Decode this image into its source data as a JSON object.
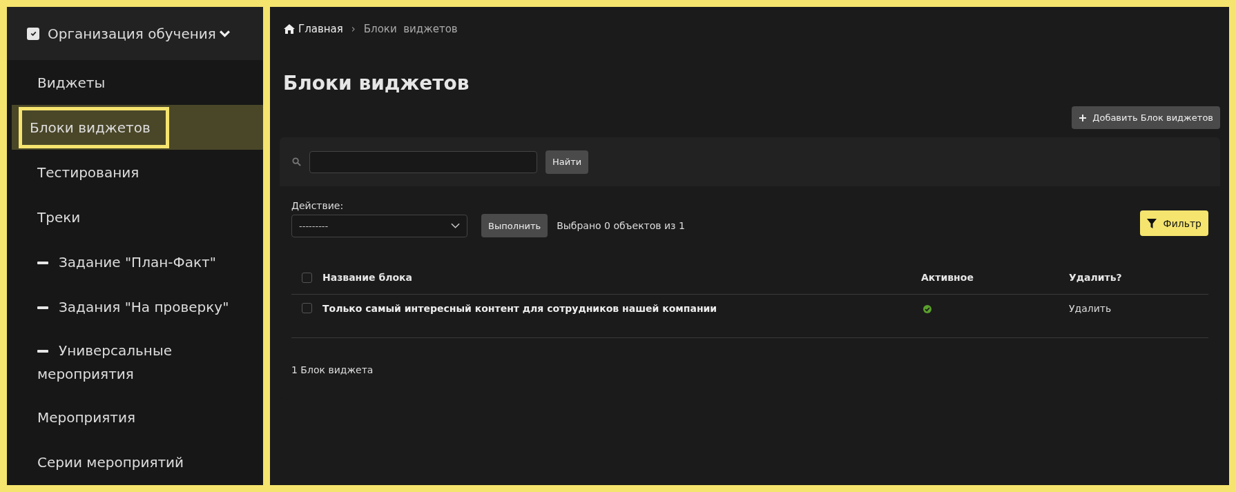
{
  "sidebar": {
    "header": {
      "label": "Организация обучения",
      "checked": true,
      "expanded": true
    },
    "items": [
      {
        "label": "Виджеты",
        "kind": "link",
        "selected": false
      },
      {
        "label": "Блоки виджетов",
        "kind": "link",
        "selected": true
      },
      {
        "label": "Тестирования",
        "kind": "link",
        "selected": false
      },
      {
        "label": "Треки",
        "kind": "link",
        "selected": false
      },
      {
        "label": "Задание \"План-Факт\"",
        "kind": "sub",
        "selected": false
      },
      {
        "label": "Задания \"На проверку\"",
        "kind": "sub",
        "selected": false
      },
      {
        "label": "Универсальные мероприятия",
        "kind": "sub",
        "selected": false
      },
      {
        "label": "Мероприятия",
        "kind": "link",
        "selected": false
      },
      {
        "label": "Серии мероприятий",
        "kind": "link",
        "selected": false
      }
    ]
  },
  "breadcrumbs": [
    "Главная",
    "Блоки  виджетов"
  ],
  "breadcrumb_separator": "›",
  "title": "Блоки виджетов",
  "add_button": "Добавить Блок виджетов",
  "search": {
    "button": "Найти"
  },
  "actions": {
    "label": "Действие:",
    "select_value": "---------",
    "run_button": "Выполнить",
    "selection_info": "Выбрано 0 объектов из 1",
    "filter_button": "Фильтр"
  },
  "table": {
    "columns": [
      "Название блока",
      "Активное",
      "Удалить?"
    ],
    "all_checked": false,
    "rows": [
      {
        "checked": false,
        "name": "Только самый интересный контент для сотрудников нашей компании",
        "active": true,
        "delete": "Удалить"
      }
    ]
  },
  "count": "1 Блок виджета"
}
